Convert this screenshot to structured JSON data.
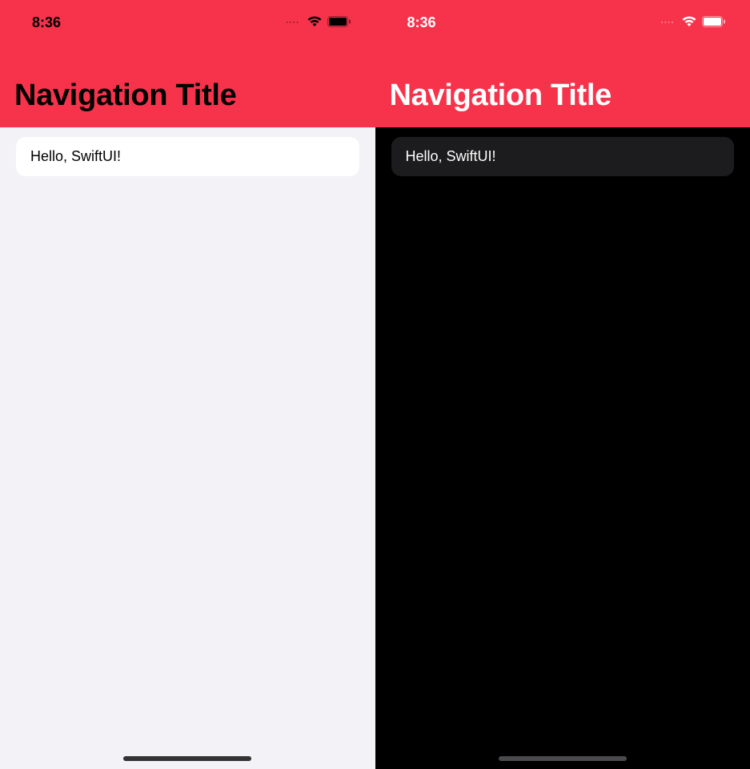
{
  "light": {
    "status": {
      "time": "8:36",
      "dots": "····"
    },
    "navigation": {
      "title": "Navigation Title"
    },
    "list": {
      "row0": "Hello, SwiftUI!"
    },
    "colors": {
      "accent": "#f7334b",
      "statusFg": "#000000",
      "batteryFill": "#000000"
    }
  },
  "dark": {
    "status": {
      "time": "8:36",
      "dots": "····"
    },
    "navigation": {
      "title": "Navigation Title"
    },
    "list": {
      "row0": "Hello, SwiftUI!"
    },
    "colors": {
      "accent": "#f7334b",
      "statusFg": "#ffffff",
      "batteryFill": "#ffffff"
    }
  }
}
